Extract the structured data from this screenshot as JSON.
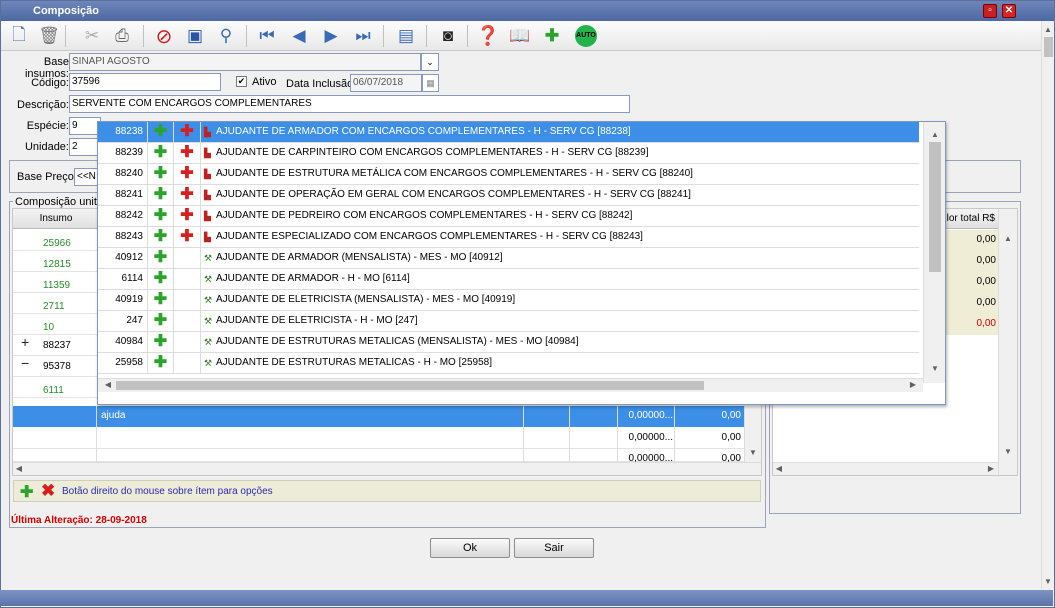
{
  "window": {
    "title": "Composição",
    "minimize_icon": "minimize-icon",
    "close_icon": "close-icon"
  },
  "toolbar": {
    "icons": [
      "new-document-icon",
      "trash-icon",
      "run-icon",
      "print-icon",
      "cancel-icon",
      "save-icon",
      "search-icon",
      "first-icon",
      "previous-icon",
      "next-icon",
      "last-icon",
      "calculator-icon",
      "camera-icon",
      "help-icon",
      "book-icon",
      "add-package-icon",
      "auto-icon"
    ],
    "auto_label": "AUTO"
  },
  "form": {
    "base_insumos_label": "Base insumos:",
    "base_insumos_value": "SINAPI AGOSTO",
    "codigo_label": "Código:",
    "codigo_value": "37596",
    "ativo_label": "Ativo",
    "ativo_checked": true,
    "data_inclusao_label": "Data Inclusão:",
    "data_inclusao_value": "06/07/2018",
    "descricao_label": "Descrição:",
    "descricao_value": "SERVENTE COM ENCARGOS COMPLEMENTARES",
    "especie_label": "Espécie:",
    "especie_value": "9",
    "unidade_label": "Unidade:",
    "unidade_value": "2",
    "base_preco_label": "Base Preço:",
    "base_preco_value": "<<N"
  },
  "composicao": {
    "legend": "Composição unitár",
    "insumo_header": "Insumo",
    "insumos": [
      {
        "code": "25966",
        "prefix": ""
      },
      {
        "code": "12815",
        "prefix": ""
      },
      {
        "code": "11359",
        "prefix": ""
      },
      {
        "code": "2711",
        "prefix": ""
      },
      {
        "code": "10",
        "prefix": ""
      },
      {
        "code": "88237",
        "prefix": "+"
      },
      {
        "code": "95378",
        "prefix": "−"
      },
      {
        "code": "6111",
        "prefix": ""
      }
    ],
    "selected_row": {
      "text": "ajuda",
      "qty": "0,00000...",
      "value": "0,00"
    },
    "rows": [
      {
        "qty": "0,00000...",
        "value": "0,00"
      },
      {
        "qty": "0,00000...",
        "value": "0,00"
      }
    ],
    "hint": "Botão direito do mouse sobre ítem para opções",
    "ultima_alteracao": "Última Alteração: 28-09-2018"
  },
  "right_panel": {
    "header": "lor total R$",
    "values": [
      {
        "v": "0,00",
        "color": "#000000"
      },
      {
        "v": "0,00",
        "color": "#000000"
      },
      {
        "v": "0,00",
        "color": "#000000"
      },
      {
        "v": "0,00",
        "color": "#000000"
      },
      {
        "v": "0,00",
        "color": "#d40000"
      }
    ]
  },
  "buttons": {
    "ok": "Ok",
    "sair": "Sair"
  },
  "popup": {
    "rows": [
      {
        "code": "88238",
        "type": "comp",
        "text": "AJUDANTE DE ARMADOR COM ENCARGOS COMPLEMENTARES - H - SERV CG [88238]",
        "selected": true
      },
      {
        "code": "88239",
        "type": "comp",
        "text": "AJUDANTE DE CARPINTEIRO COM ENCARGOS COMPLEMENTARES - H - SERV CG [88239]"
      },
      {
        "code": "88240",
        "type": "comp",
        "text": "AJUDANTE DE ESTRUTURA METÁLICA COM ENCARGOS COMPLEMENTARES - H - SERV CG [88240]"
      },
      {
        "code": "88241",
        "type": "comp",
        "text": "AJUDANTE DE OPERAÇÃO EM GERAL COM ENCARGOS COMPLEMENTARES - H - SERV CG [88241]"
      },
      {
        "code": "88242",
        "type": "comp",
        "text": "AJUDANTE DE PEDREIRO COM ENCARGOS COMPLEMENTARES - H - SERV CG [88242]"
      },
      {
        "code": "88243",
        "type": "comp",
        "text": "AJUDANTE ESPECIALIZADO COM ENCARGOS COMPLEMENTARES - H - SERV CG [88243]"
      },
      {
        "code": "40912",
        "type": "ins",
        "text": "AJUDANTE DE ARMADOR (MENSALISTA) - MES - MO [40912]"
      },
      {
        "code": "6114",
        "type": "ins",
        "text": "AJUDANTE DE ARMADOR - H - MO [6114]"
      },
      {
        "code": "40919",
        "type": "ins",
        "text": "AJUDANTE DE ELETRICISTA (MENSALISTA) - MES - MO [40919]"
      },
      {
        "code": "247",
        "type": "ins",
        "text": "AJUDANTE DE ELETRICISTA - H - MO [247]"
      },
      {
        "code": "40984",
        "type": "ins",
        "text": "AJUDANTE DE ESTRUTURAS METALICAS (MENSALISTA) - MES - MO [40984]"
      },
      {
        "code": "25958",
        "type": "ins",
        "text": "AJUDANTE DE ESTRUTURAS METALICAS - H - MO [25958]"
      }
    ]
  }
}
